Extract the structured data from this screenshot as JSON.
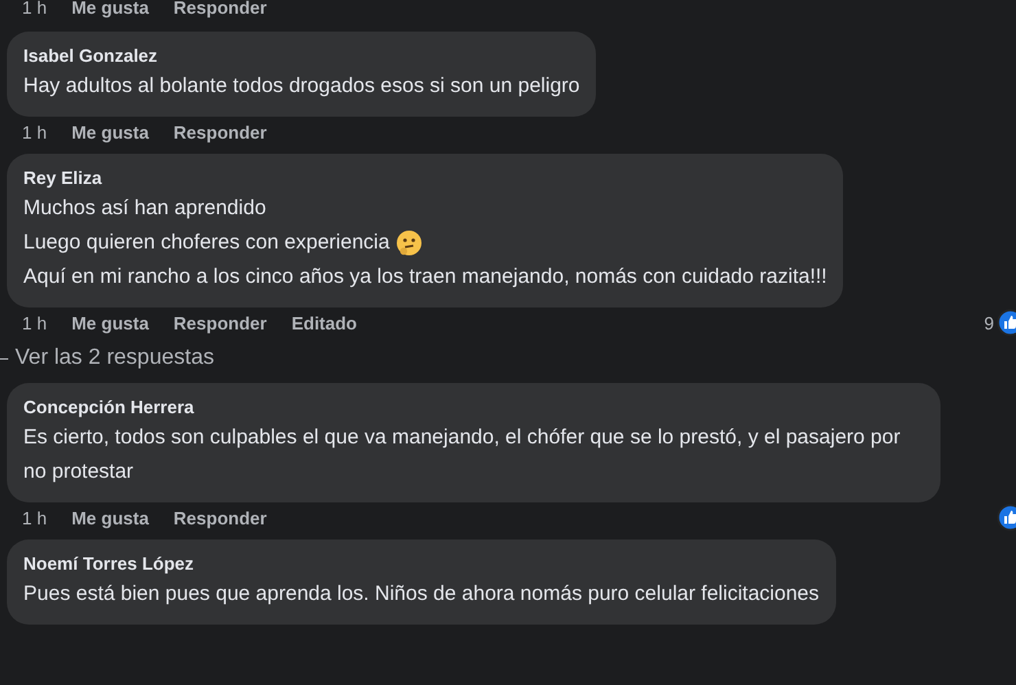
{
  "thread": [
    {
      "kind": "actions",
      "time": "1 h",
      "like": "Me gusta",
      "reply": "Responder"
    },
    {
      "kind": "comment",
      "author": "Isabel Gonzalez",
      "lines": [
        {
          "text": "Hay adultos al bolante todos drogados esos si son un peligro"
        }
      ],
      "time": "1 h",
      "like": "Me gusta",
      "reply": "Responder"
    },
    {
      "kind": "comment",
      "author": "Rey Eliza",
      "lines": [
        {
          "text": "Muchos así han aprendido"
        },
        {
          "text": "Luego quieren choferes con experiencia",
          "emoji": true
        },
        {
          "text": "Aquí en mi rancho a los cinco años ya los traen manejando, nomás con cuidado razita!!!"
        }
      ],
      "time": "1 h",
      "like": "Me gusta",
      "reply": "Responder",
      "edited": "Editado",
      "liked": true,
      "reactions": "9"
    },
    {
      "kind": "replies",
      "label": "Ver las 2 respuestas"
    },
    {
      "kind": "comment",
      "author": "Concepción Herrera",
      "lines": [
        {
          "text": "Es cierto, todos son culpables el que va manejando, el chófer que se lo prestó, y el pasajero por no protestar"
        }
      ],
      "time": "1 h",
      "like": "Me gusta",
      "reply": "Responder",
      "liked": true
    },
    {
      "kind": "comment",
      "author": "Noemí Torres López",
      "lines": [
        {
          "text": "Pues está bien pues que aprenda los. Niños de ahora nomás puro celular felicitaciones"
        }
      ]
    }
  ]
}
